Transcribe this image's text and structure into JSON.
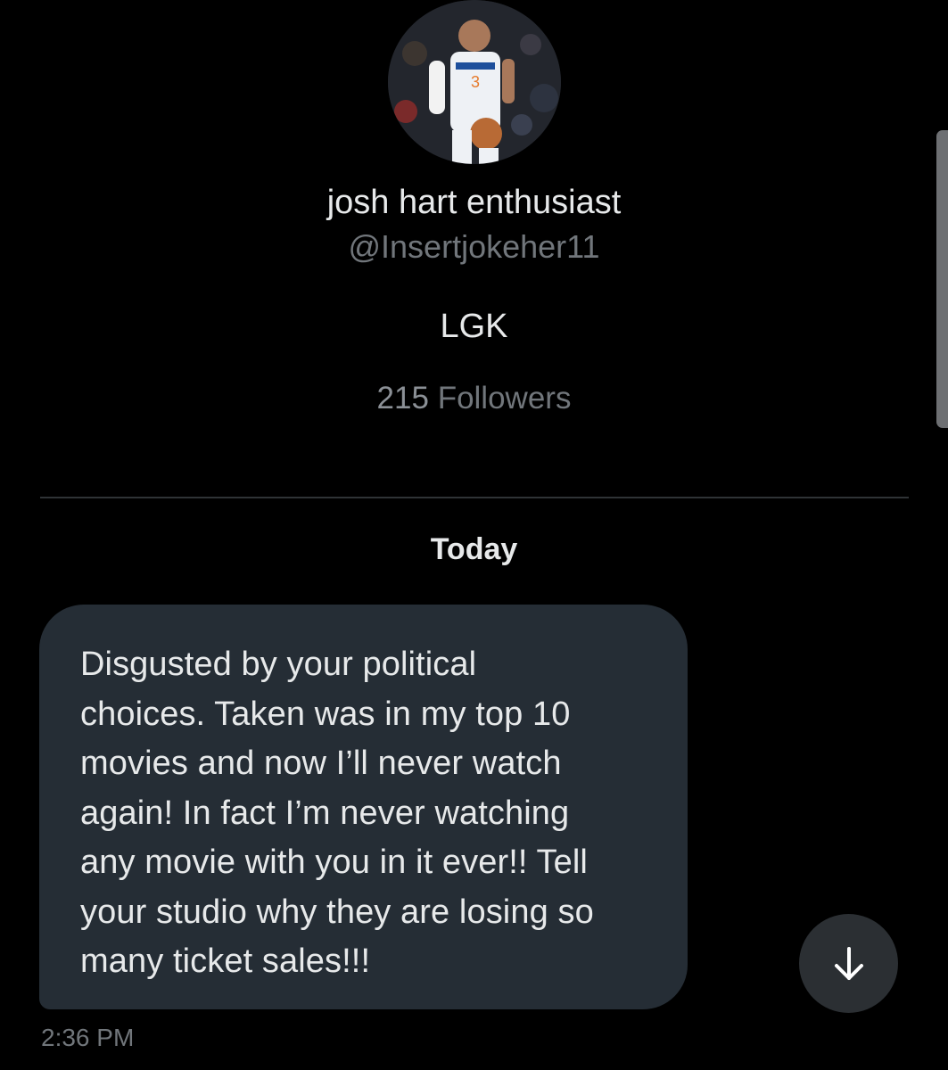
{
  "profile": {
    "display_name": "josh hart enthusiast",
    "handle": "@Insertjokeher11",
    "bio": "LGK",
    "followers_count": "215",
    "followers_label": "Followers",
    "avatar_icon": "profile-photo-basketball-player"
  },
  "conversation": {
    "date_separator": "Today",
    "messages": [
      {
        "text": "Disgusted by your political\nchoices. Taken was in my top 10\nmovies and now I’ll never watch\nagain! In fact I’m never watching\nany movie with you in it ever!! Tell\nyour studio why they are losing so\nmany ticket sales!!!",
        "time": "2:36 PM"
      }
    ]
  },
  "controls": {
    "scroll_down_icon": "arrow-down-icon"
  },
  "colors": {
    "background": "#000000",
    "bubble": "#252d35",
    "primary_text": "#e7e9ea",
    "secondary_text": "#71767b",
    "divider": "#2f3336",
    "scroll_button": "#2b2f33"
  }
}
